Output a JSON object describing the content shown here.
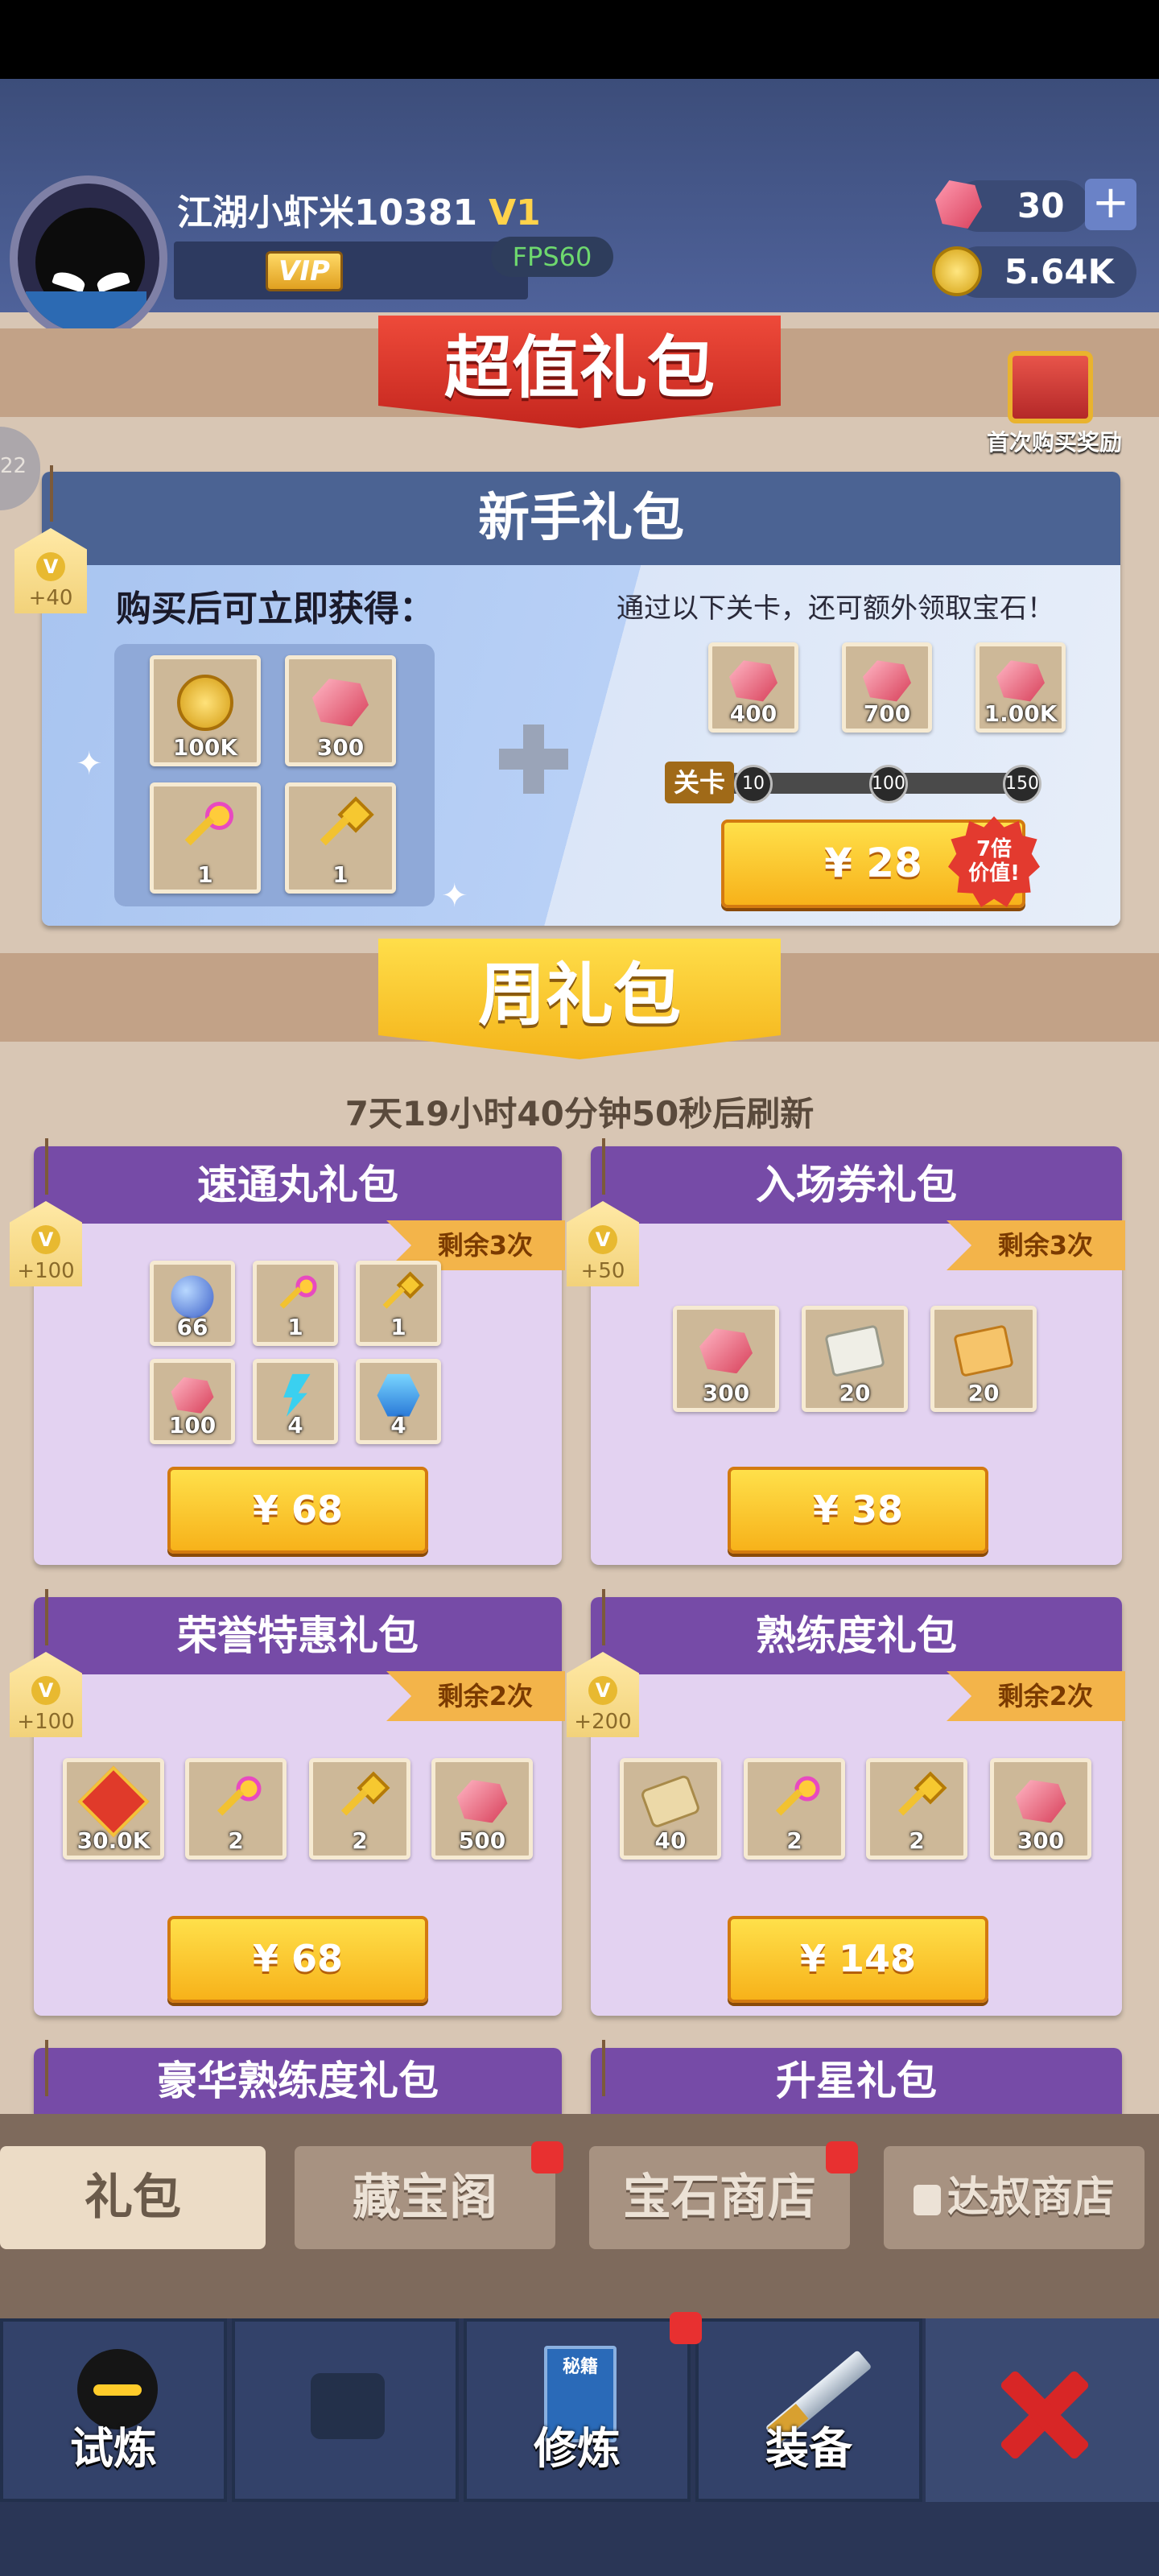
{
  "header": {
    "username": "江湖小虾米10381",
    "vip_level": "V1",
    "vip_badge": "VIP",
    "fps": "FPS60",
    "gems": "30",
    "coins": "5.64K",
    "plus": "+"
  },
  "banner_super": {
    "title": "超值礼包",
    "chest_label": "首次购买奖励",
    "side_label": "22"
  },
  "newbie": {
    "title": "新手礼包",
    "tag": "+40",
    "tag_coin": "V",
    "left_text": "购买后可立即获得：",
    "right_text": "通过以下关卡，还可额外领取宝石！",
    "items": [
      {
        "icon": "gold-coins-icon",
        "count": "100K"
      },
      {
        "icon": "gem-icon",
        "count": "300"
      },
      {
        "icon": "pink-key-icon",
        "count": "1"
      },
      {
        "icon": "gold-key-icon",
        "count": "1"
      }
    ],
    "rewards": [
      {
        "icon": "gem-icon",
        "count": "400"
      },
      {
        "icon": "gem-icon",
        "count": "700"
      },
      {
        "icon": "gem-icon",
        "count": "1.00K"
      }
    ],
    "stage_label": "关卡",
    "stages": [
      "10",
      "100",
      "150"
    ],
    "price": "¥ 28",
    "badge": "7倍\n价值!"
  },
  "banner_week": {
    "title": "周礼包",
    "countdown": "7天19小时40分钟50秒后刷新"
  },
  "packs": [
    {
      "title": "速通丸礼包",
      "tag": "+100",
      "remain": "剩余3次",
      "price": "¥ 68",
      "items": [
        {
          "icon": "blue-orb-icon",
          "count": "66"
        },
        {
          "icon": "pink-key-icon",
          "count": "1"
        },
        {
          "icon": "gold-key-icon",
          "count": "1"
        },
        {
          "icon": "gem-icon",
          "count": "100"
        },
        {
          "icon": "lightning-icon",
          "count": "4"
        },
        {
          "icon": "blue-crystal-icon",
          "count": "4"
        }
      ]
    },
    {
      "title": "入场券礼包",
      "tag": "+50",
      "remain": "剩余3次",
      "price": "¥ 38",
      "items": [
        {
          "icon": "gem-icon",
          "count": "300"
        },
        {
          "icon": "white-scroll-icon",
          "count": "20"
        },
        {
          "icon": "orange-scroll-icon",
          "count": "20"
        }
      ]
    },
    {
      "title": "荣誉特惠礼包",
      "tag": "+100",
      "remain": "剩余2次",
      "price": "¥ 68",
      "items": [
        {
          "icon": "honor-badge-icon",
          "count": "30.0K"
        },
        {
          "icon": "pink-key-icon",
          "count": "2"
        },
        {
          "icon": "gold-key-icon",
          "count": "2"
        },
        {
          "icon": "gem-icon",
          "count": "500"
        }
      ]
    },
    {
      "title": "熟练度礼包",
      "tag": "+200",
      "remain": "剩余2次",
      "price": "¥ 148",
      "items": [
        {
          "icon": "parchment-icon",
          "count": "40"
        },
        {
          "icon": "pink-key-icon",
          "count": "2"
        },
        {
          "icon": "gold-key-icon",
          "count": "2"
        },
        {
          "icon": "gem-icon",
          "count": "300"
        }
      ]
    },
    {
      "title": "豪华熟练度礼包"
    },
    {
      "title": "升星礼包"
    }
  ],
  "shop_tabs": [
    {
      "label": "礼包",
      "active": true
    },
    {
      "label": "藏宝阁"
    },
    {
      "label": "宝石商店"
    },
    {
      "label": "达叔商店"
    }
  ],
  "bottom_nav": [
    {
      "label": "试炼"
    },
    {
      "label": ""
    },
    {
      "label": "修炼",
      "book_text": "秘籍"
    },
    {
      "label": "装备"
    }
  ],
  "tag_coin": "V"
}
